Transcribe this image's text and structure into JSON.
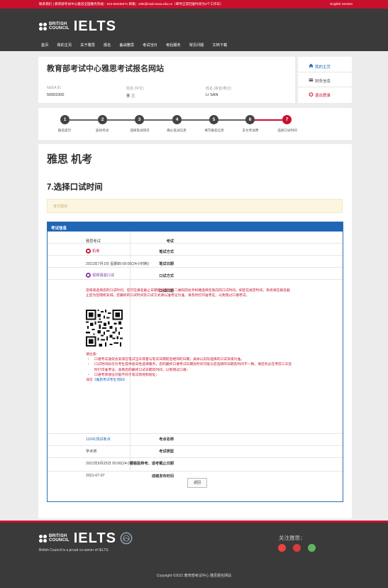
{
  "topbar": {
    "contact": "联系我们 | 教育部考试中心雅思全国服务热线：010-82345671  邮箱：ielts@mail.neea.edu.cn（邮件正常回复时间为2个工作日）",
    "english_link": "English Version"
  },
  "brand": {
    "british": "BRITISH",
    "council": "COUNCIL",
    "ielts": "IELTS"
  },
  "nav": [
    "首页",
    "我的主页",
    "关于雅思",
    "报名",
    "备战雅思",
    "考试当日",
    "考后服务",
    "常见问题",
    "文档下载"
  ],
  "site_title": "教育部考试中心雅思考试报名网站",
  "user_info": {
    "id_label": "NEEA ID",
    "id_value": "50002300",
    "name_label": "姓名 (中文)",
    "name_value": "李 三",
    "pinyin_label": "姓名 (拼音/英文)",
    "pinyin_value": "LI SAN"
  },
  "right_links": {
    "home": "我的主页",
    "finance": "财务信息",
    "logout": "退出登录"
  },
  "steps": [
    {
      "num": "1",
      "label": "报名提示"
    },
    {
      "num": "2",
      "label": "查找考试"
    },
    {
      "num": "3",
      "label": "选择笔试场次"
    },
    {
      "num": "4",
      "label": "确认笔试信息"
    },
    {
      "num": "5",
      "label": "填写报名信息"
    },
    {
      "num": "6",
      "label": "支付考试费"
    },
    {
      "num": "7",
      "label": "选择口试时间"
    }
  ],
  "exam_title": "雅思 机考",
  "page_subtitle": "7.选择口试时间",
  "alert_text": "支付成功",
  "table": {
    "header": "考试信息",
    "rows": {
      "exam_label": "考试",
      "exam_value": "雅思考试",
      "written_mode_label": "笔试方式",
      "written_mode_value": "机考",
      "written_date_label": "笔试日期",
      "written_date_value": "2021年7月1日 星期四 09:00(24小时制)",
      "oral_mode_label": "口试方式",
      "oral_mode_value": "视频语音口试",
      "oral_date_label": "口试日期",
      "oral_date_text": "您将来选择您的口试时间，您可在报名截止日期前扫描下方二维码前往手机端选择您意向的口试时间。如您在规定时间，系统将在报名截止后为您随机安排。您最终的口试时间及口试方式请以准考证为准，请及时打印准考证，以免错过口语考试。",
      "notes_title": "请注意：",
      "notes": [
        "口语考试通常会安排在笔试当天或者与笔试日期前后相邻的日期，具体以实际选择的口试安排为准。",
        "口试时间段仅为考生提供意向性选择服务，您的最终口语考试日期及时间可能与您选择的日期及时间不一致，请您务必在考前三天及时打印准考证，查看您的最终口试日期及时间，以免错过口语；",
        "口语考场地址可能不同于笔试场地和地址；"
      ],
      "notes_link_prefix": "详见",
      "notes_link": "《雅思考试考生须知》",
      "center_label": "考点名称",
      "center_value": "11041测试考点",
      "category_label": "考试类型",
      "category_value": "学术类",
      "deadline_label": "报名及转考、退考截止日期",
      "deadline_value": "2021年6月25日 05:00(24小时制)",
      "result_label": "成绩发布时间",
      "result_value": "2021-07-07"
    },
    "back_button": "返回"
  },
  "footer": {
    "caption": "British Council is a proud co-owner of IELTS",
    "follow": "关注雅思：",
    "copyright": "Copyright ©2021 教育部考试中心 雅思报名网站"
  },
  "colors": {
    "brand_red": "#c8102e",
    "table_blue": "#1f66b7",
    "dark_header": "#3a3a3a",
    "step_gray": "#444444",
    "alert_bg": "#fcf6e0"
  },
  "icons": {
    "home": "home-icon",
    "finance": "finance-icon",
    "logout": "power-icon",
    "computer": "computer-icon",
    "video": "video-icon",
    "qr": "qr-code",
    "wechat": "wechat-icon",
    "weibo": "weibo-icon",
    "app": "app-icon"
  }
}
